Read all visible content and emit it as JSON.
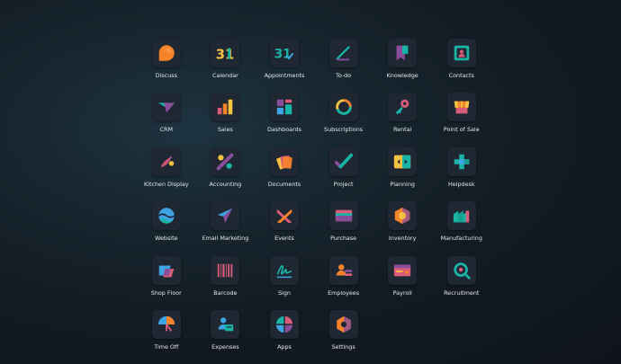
{
  "apps": [
    {
      "label": "Discuss",
      "icon": "discuss-icon"
    },
    {
      "label": "Calendar",
      "icon": "calendar-icon"
    },
    {
      "label": "Appointments",
      "icon": "appointments-icon"
    },
    {
      "label": "To-do",
      "icon": "todo-icon"
    },
    {
      "label": "Knowledge",
      "icon": "knowledge-icon"
    },
    {
      "label": "Contacts",
      "icon": "contacts-icon"
    },
    {
      "label": "CRM",
      "icon": "crm-icon"
    },
    {
      "label": "Sales",
      "icon": "sales-icon"
    },
    {
      "label": "Dashboards",
      "icon": "dashboards-icon"
    },
    {
      "label": "Subscriptions",
      "icon": "subscriptions-icon"
    },
    {
      "label": "Rental",
      "icon": "rental-icon"
    },
    {
      "label": "Point of Sale",
      "icon": "point-of-sale-icon"
    },
    {
      "label": "Kitchen Display",
      "icon": "kitchen-display-icon"
    },
    {
      "label": "Accounting",
      "icon": "accounting-icon"
    },
    {
      "label": "Documents",
      "icon": "documents-icon"
    },
    {
      "label": "Project",
      "icon": "project-icon"
    },
    {
      "label": "Planning",
      "icon": "planning-icon"
    },
    {
      "label": "Helpdesk",
      "icon": "helpdesk-icon"
    },
    {
      "label": "Website",
      "icon": "website-icon"
    },
    {
      "label": "Email Marketing",
      "icon": "email-marketing-icon"
    },
    {
      "label": "Events",
      "icon": "events-icon"
    },
    {
      "label": "Purchase",
      "icon": "purchase-icon"
    },
    {
      "label": "Inventory",
      "icon": "inventory-icon"
    },
    {
      "label": "Manufacturing",
      "icon": "manufacturing-icon"
    },
    {
      "label": "Shop Floor",
      "icon": "shop-floor-icon"
    },
    {
      "label": "Barcode",
      "icon": "barcode-icon"
    },
    {
      "label": "Sign",
      "icon": "sign-icon"
    },
    {
      "label": "Employees",
      "icon": "employees-icon"
    },
    {
      "label": "Payroll",
      "icon": "payroll-icon"
    },
    {
      "label": "Recruitment",
      "icon": "recruitment-icon"
    },
    {
      "label": "Time Off",
      "icon": "time-off-icon"
    },
    {
      "label": "Expenses",
      "icon": "expenses-icon"
    },
    {
      "label": "Apps",
      "icon": "apps-icon"
    },
    {
      "label": "Settings",
      "icon": "settings-icon"
    }
  ],
  "calendar_day": "31",
  "colors": {
    "orange": "#F5832A",
    "teal": "#1AB4A6",
    "purple": "#8A4D9A",
    "pink": "#D95C7A",
    "yellow": "#F5C242",
    "blue": "#3FA4E3",
    "tile_bg": "#1F2733",
    "label": "#E6E8EC"
  }
}
